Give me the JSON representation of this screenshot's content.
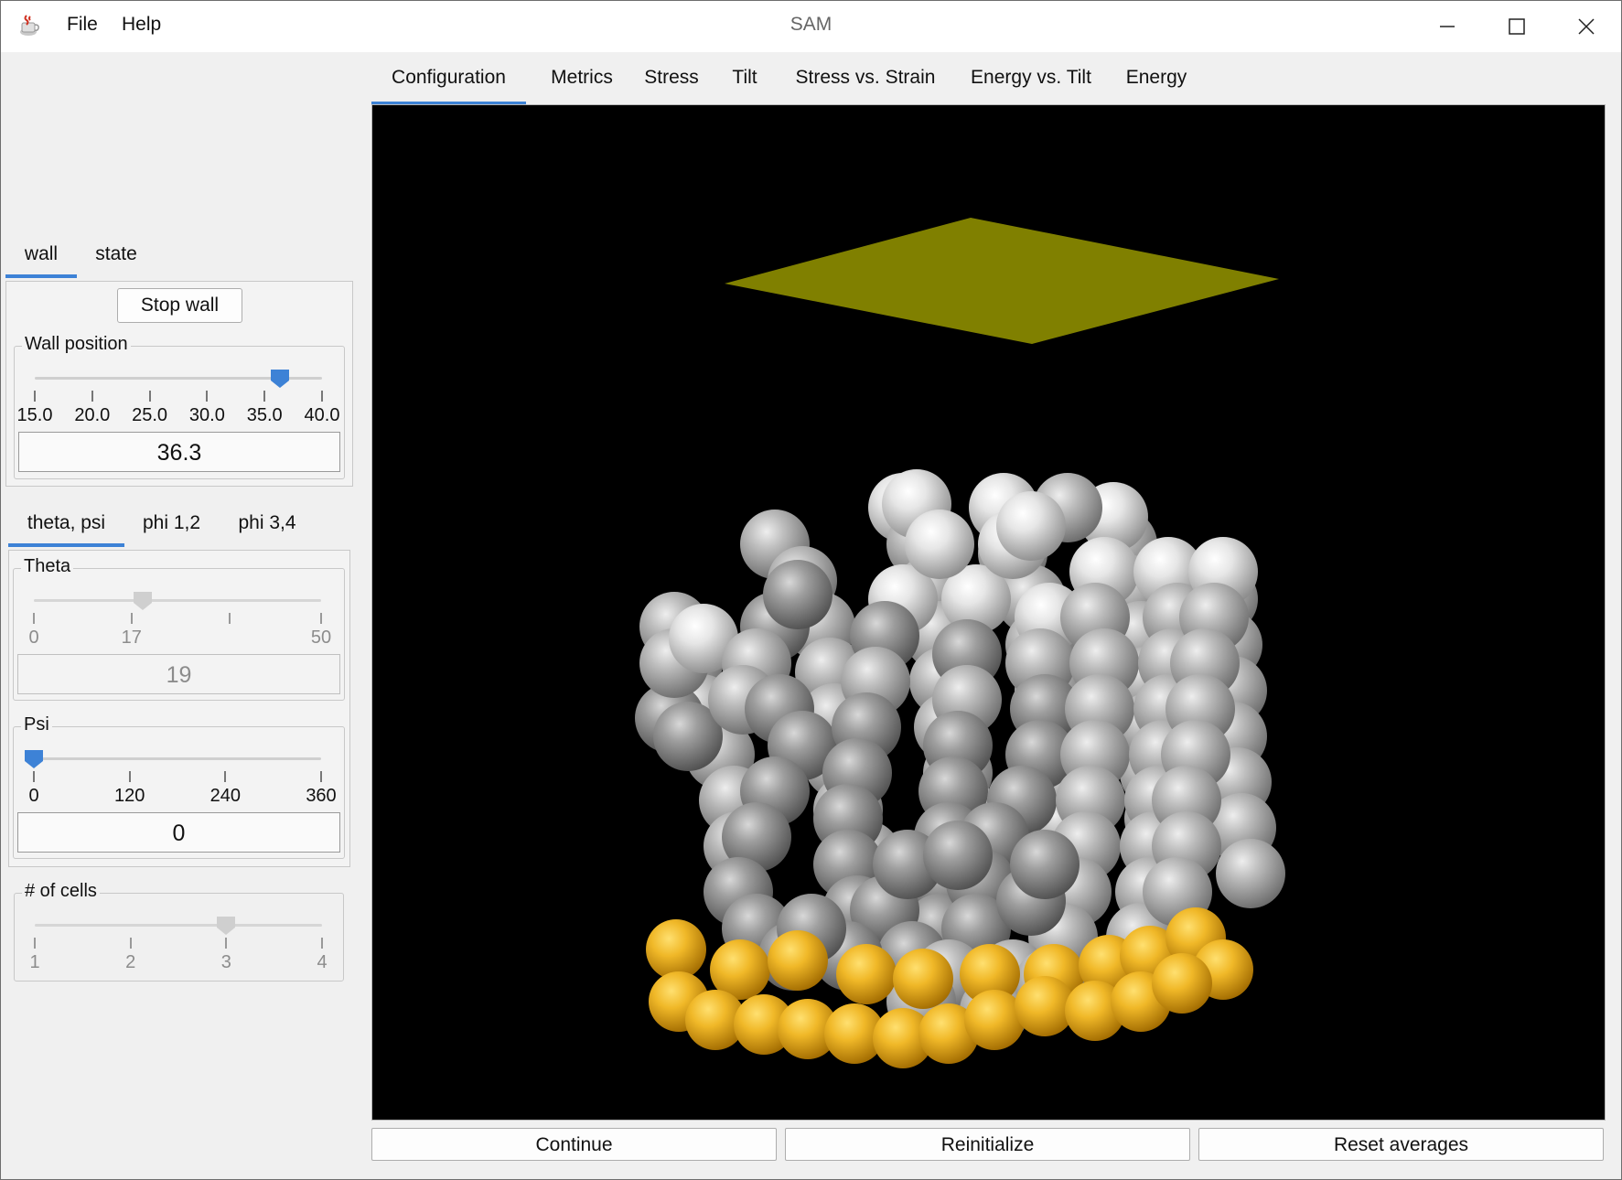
{
  "window": {
    "title": "SAM",
    "menu": [
      "File",
      "Help"
    ]
  },
  "main_tabs": [
    "Configuration",
    "Metrics",
    "Stress",
    "Tilt",
    "Stress vs. Strain",
    "Energy vs. Tilt",
    "Energy"
  ],
  "active_main_tab": "Configuration",
  "bottom_buttons": {
    "continue": "Continue",
    "reinitialize": "Reinitialize",
    "reset_averages": "Reset averages"
  },
  "sidebar": {
    "top_tabs": [
      "wall",
      "state"
    ],
    "stop_wall_button": "Stop wall",
    "wall_position": {
      "label": "Wall position",
      "ticks": [
        "15.0",
        "20.0",
        "25.0",
        "30.0",
        "35.0",
        "40.0"
      ],
      "min": 15.0,
      "max": 40.0,
      "value": 36.3,
      "display": "36.3"
    },
    "angle_tabs": [
      "theta, psi",
      "phi 1,2",
      "phi 3,4"
    ],
    "theta": {
      "label": "Theta",
      "ticks": [
        "0",
        "17",
        "",
        "50"
      ],
      "min": 0,
      "max": 50,
      "value": 19,
      "display": "19",
      "enabled": false
    },
    "psi": {
      "label": "Psi",
      "ticks": [
        "0",
        "120",
        "240",
        "360"
      ],
      "min": 0,
      "max": 360,
      "value": 0,
      "display": "0"
    },
    "cells": {
      "label": "# of cells",
      "ticks": [
        "1",
        "2",
        "3",
        "4"
      ],
      "min": 1,
      "max": 4,
      "value": 3,
      "enabled": false
    }
  },
  "colors": {
    "accent": "#3d82d6",
    "wall_plane": "#808000",
    "chain_atoms": "#c8c8c8",
    "substrate_atoms": "#e8b020",
    "viewport_bg": "#000000"
  }
}
